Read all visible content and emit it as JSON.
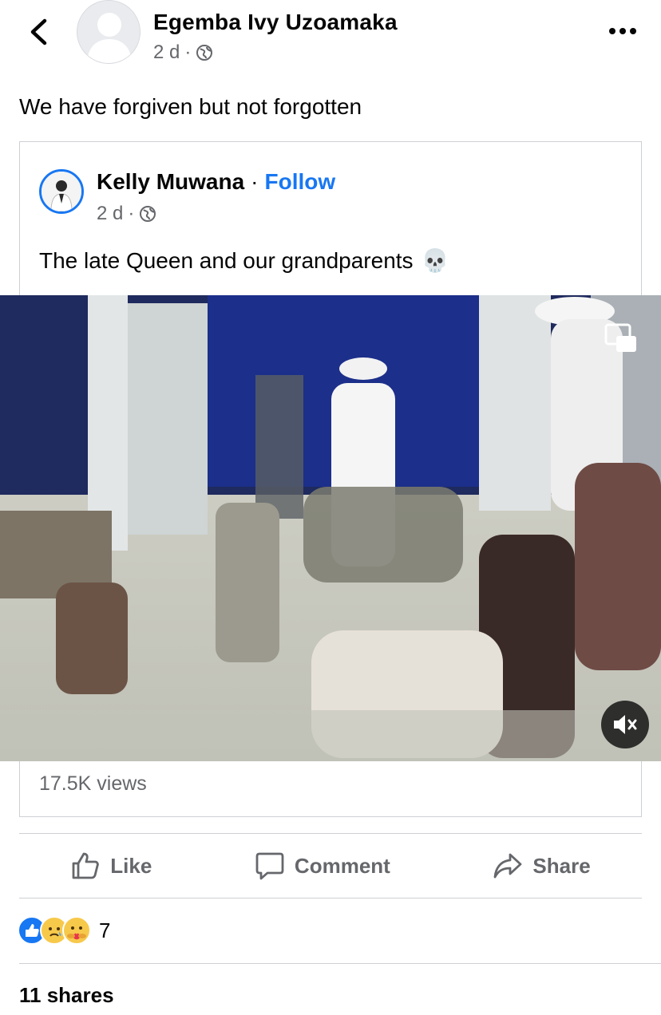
{
  "header": {
    "author_name": "Egemba Ivy Uzoamaka",
    "time": "2 d",
    "separator": "·"
  },
  "post": {
    "text": "We have forgiven but not forgotten"
  },
  "shared": {
    "author_name": "Kelly Muwana",
    "separator": "·",
    "follow_label": "Follow",
    "time": "2 d",
    "text": "The late Queen and our grandparents",
    "emoji": "💀",
    "views": "17.5K views"
  },
  "actions": {
    "like": "Like",
    "comment": "Comment",
    "share": "Share"
  },
  "reactions": {
    "count": "7"
  },
  "shares": "11 shares",
  "colors": {
    "accent": "#1877f2",
    "secondary_text": "#65676b",
    "border": "#ced0d4"
  }
}
